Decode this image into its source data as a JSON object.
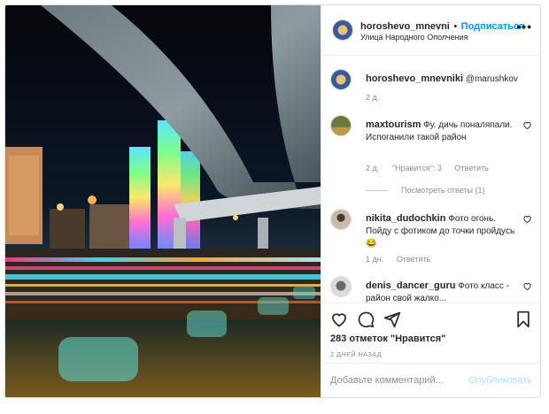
{
  "post": {
    "author": "horoshevo_mnevni",
    "separator": "•",
    "follow_label": "Подписаться",
    "location": "Улица Народного Ополчения",
    "more_label": "•••"
  },
  "caption": {
    "author": "horoshevo_mnevniki",
    "text": "@marushkov",
    "age": "2 д."
  },
  "comments": [
    {
      "author": "maxtourism",
      "text": "Фу. дичь поналяпали. Испоганили такой район",
      "age": "2 д.",
      "likes_label": "\"Нравится\": 3",
      "reply_label": "Ответить",
      "view_replies": "Посмотреть ответы (1)"
    },
    {
      "author": "nikita_dudochkin",
      "text": "Фото огонь. Пойду с фотиком до точки пройдусь😂",
      "age": "1 дн.",
      "reply_label": "Ответить"
    },
    {
      "author": "denis_dancer_guru",
      "text": "Фото класс - район свой жалко..."
    }
  ],
  "likes_count": "283 отметок \"Нравится\"",
  "timestamp": "2 ДНЕЙ НАЗАД",
  "add_comment": {
    "placeholder": "Добавьте комментарий...",
    "publish_label": "Опубликовать"
  },
  "icons": {
    "like": "heart-icon",
    "comment": "comment-icon",
    "share": "share-icon",
    "save": "bookmark-icon"
  },
  "colors": {
    "accent": "#0095f6",
    "publish_disabled": "#b2dffc",
    "muted": "#8e8e8e"
  }
}
